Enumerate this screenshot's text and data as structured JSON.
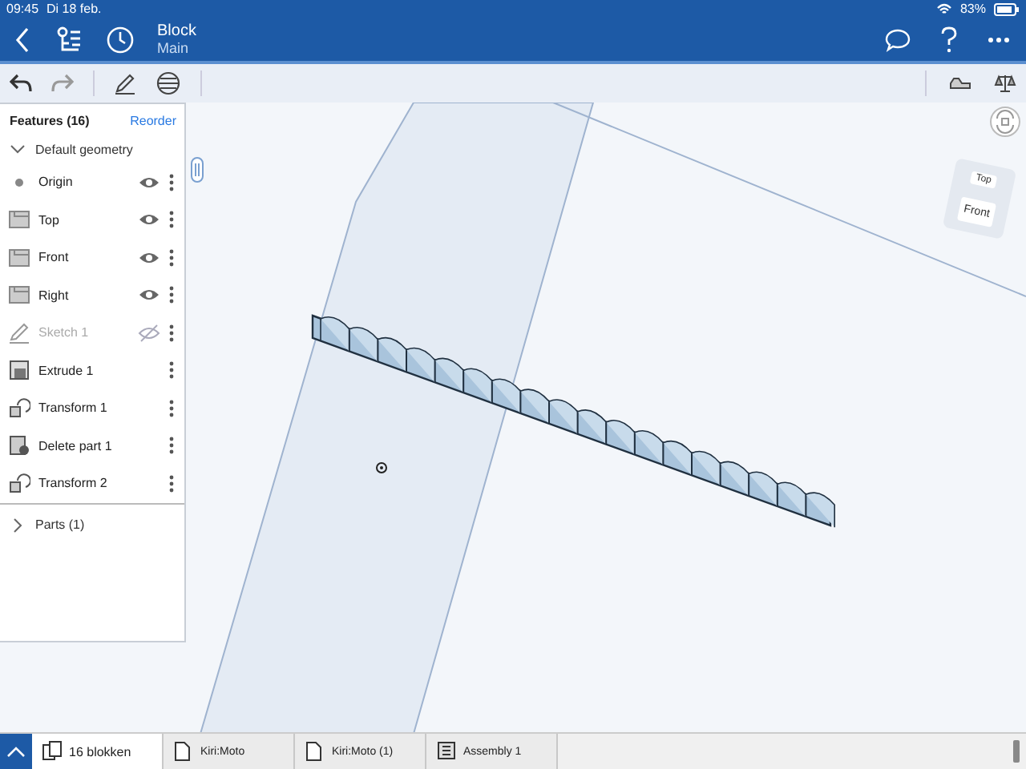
{
  "status_bar": {
    "time": "09:45",
    "date": "Di 18 feb.",
    "battery": "83%"
  },
  "header": {
    "title": "Block",
    "subtitle": "Main"
  },
  "features": {
    "title": "Features (16)",
    "reorder": "Reorder",
    "group": {
      "label": "Default geometry",
      "expanded": true
    },
    "items": [
      {
        "kind": "origin",
        "label": "Origin",
        "visible": true
      },
      {
        "kind": "plane",
        "label": "Top",
        "visible": true
      },
      {
        "kind": "plane",
        "label": "Front",
        "visible": true
      },
      {
        "kind": "plane",
        "label": "Right",
        "visible": true
      },
      {
        "kind": "sketch",
        "label": "Sketch 1",
        "visible": false
      },
      {
        "kind": "extrude",
        "label": "Extrude 1"
      },
      {
        "kind": "transform",
        "label": "Transform 1"
      },
      {
        "kind": "delete",
        "label": "Delete part 1"
      },
      {
        "kind": "transform",
        "label": "Transform 2"
      }
    ],
    "parts": {
      "label": "Parts (1)",
      "expanded": false
    }
  },
  "view_cube": {
    "top": "Top",
    "front": "Front"
  },
  "tabs": [
    {
      "kind": "studio",
      "label": "16 blokken",
      "selected": true
    },
    {
      "kind": "document",
      "label": "Kiri:Moto",
      "selected": false
    },
    {
      "kind": "document",
      "label": "Kiri:Moto (1)",
      "selected": false
    },
    {
      "kind": "assembly",
      "label": "Assembly 1",
      "selected": false
    }
  ]
}
